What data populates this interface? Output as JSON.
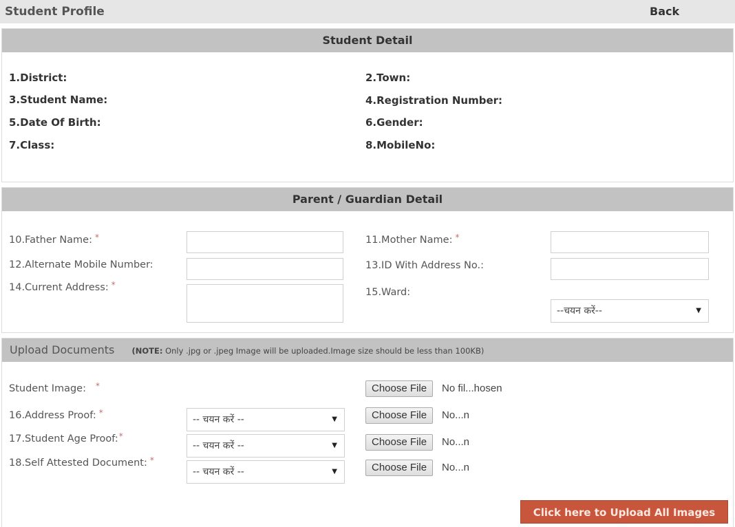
{
  "header": {
    "title": "Student Profile",
    "back_label": "Back"
  },
  "student_detail": {
    "heading": "Student Detail",
    "fields": [
      "1.District:",
      "2.Town:",
      "3.Student Name:",
      "4.Registration Number:",
      "5.Date Of Birth:",
      "6.Gender:",
      "7.Class:",
      "8.MobileNo:"
    ]
  },
  "parent_detail": {
    "heading": "Parent / Guardian Detail",
    "father_name": {
      "label": "10.Father Name:",
      "required": "*",
      "value": ""
    },
    "mother_name": {
      "label": "11.Mother Name:",
      "required": "*",
      "value": ""
    },
    "alt_mobile": {
      "label": "12.Alternate Mobile Number:",
      "value": ""
    },
    "id_address": {
      "label": "13.ID With Address No.:",
      "value": ""
    },
    "current_address": {
      "label": "14.Current Address:",
      "required": "*",
      "value": ""
    },
    "ward": {
      "label": "15.Ward:",
      "selected": "--चयन करें--"
    }
  },
  "upload": {
    "heading": "Upload Documents",
    "note_bold": "(NOTE:",
    "note_text": " Only .jpg or .jpeg Image will be uploaded.Image size should be less than 100KB)",
    "choose_file_label": "Choose File",
    "rows": [
      {
        "label": "Student Image:",
        "required": "*",
        "file_status": "No fil...hosen"
      },
      {
        "label": "16.Address Proof:",
        "required": "*",
        "selected": "-- चयन करें --",
        "file_status": "No...n"
      },
      {
        "label": "17.Student Age Proof:",
        "required": "*",
        "selected": "-- चयन करें --",
        "file_status": "No...n"
      },
      {
        "label": "18.Self Attested Document:",
        "required": "*",
        "selected": "-- चयन करें --",
        "file_status": "No...n"
      }
    ],
    "submit_label": "Click here to Upload All Images"
  },
  "icons": {
    "dropdown": "▼"
  },
  "colors": {
    "header_bg": "#c2c2c2",
    "upload_button": "#c8563c",
    "required": "#c07070"
  }
}
